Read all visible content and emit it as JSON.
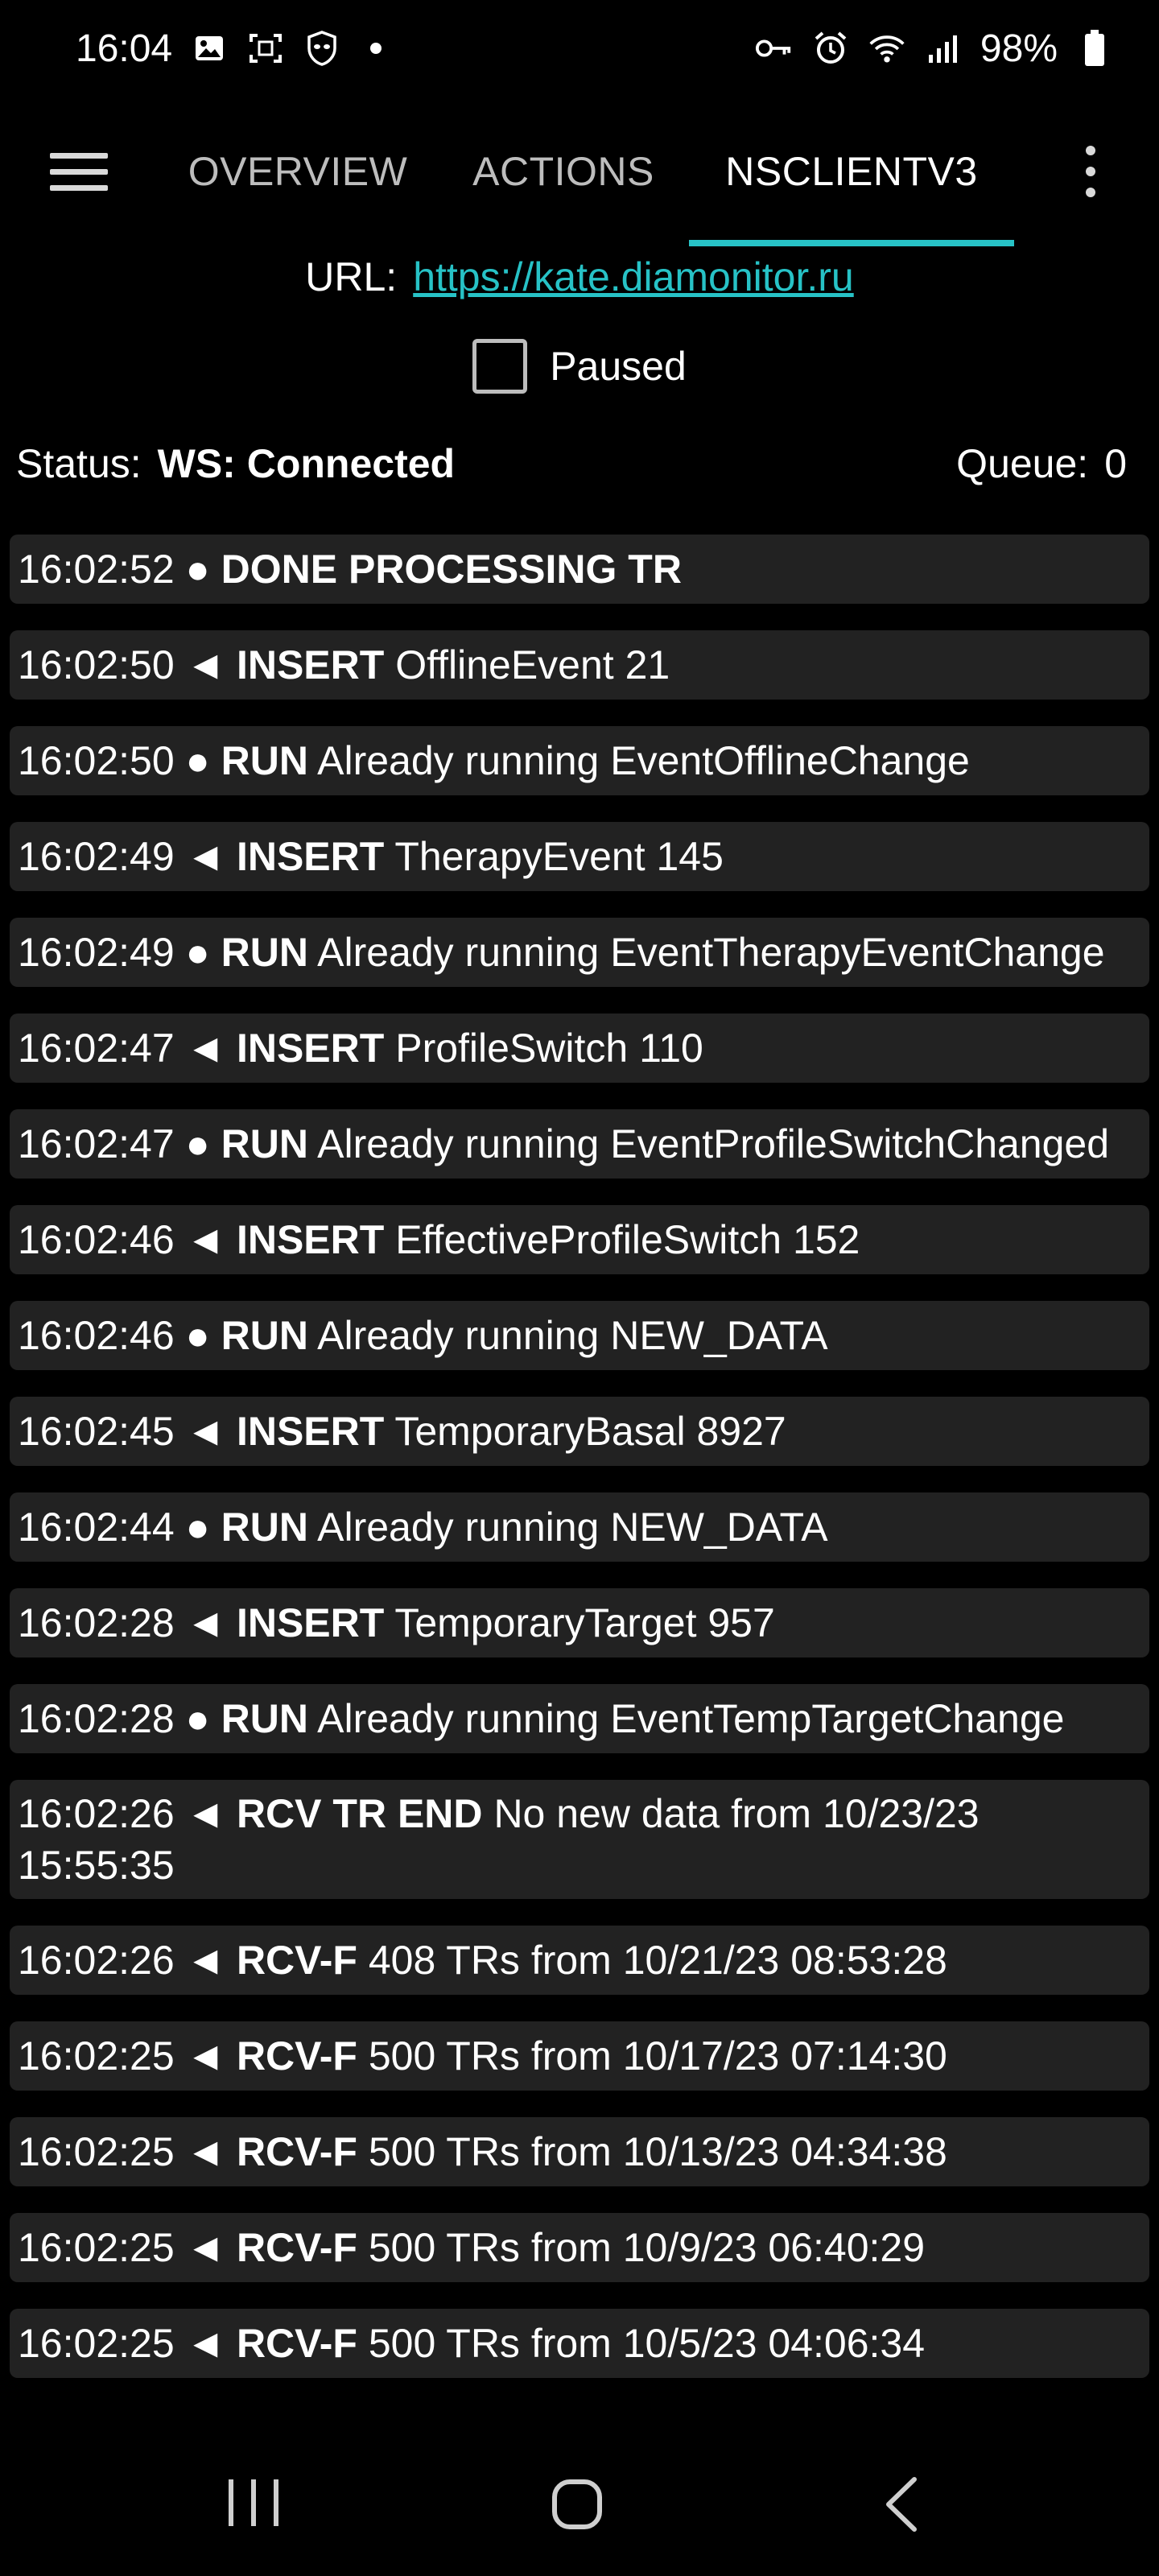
{
  "status_bar": {
    "time": "16:04",
    "left_icons": [
      "image-icon",
      "screenshot-icon",
      "alien-shield-icon",
      "notification-dot"
    ],
    "right_icons": [
      "key-icon",
      "alarm-icon",
      "wifi-icon",
      "signal-icon"
    ],
    "battery_percent": "98%"
  },
  "tabs": [
    {
      "label": "OVERVIEW",
      "active": false
    },
    {
      "label": "ACTIONS",
      "active": false
    },
    {
      "label": "NSCLIENTV3",
      "active": true
    }
  ],
  "url": {
    "label": "URL:",
    "value": "https://kate.diamonitor.ru"
  },
  "paused": {
    "label": "Paused",
    "checked": false
  },
  "status": {
    "label": "Status:",
    "value": "WS: Connected",
    "queue_label": "Queue:",
    "queue_value": "0"
  },
  "log": [
    {
      "time": "16:02:52",
      "dir": "●",
      "action": "DONE PROCESSING TR",
      "detail": ""
    },
    {
      "time": "16:02:50",
      "dir": "◄",
      "action": "INSERT",
      "detail": "OfflineEvent 21"
    },
    {
      "time": "16:02:50",
      "dir": "●",
      "action": "RUN",
      "detail": "Already running EventOfflineChange"
    },
    {
      "time": "16:02:49",
      "dir": "◄",
      "action": "INSERT",
      "detail": "TherapyEvent 145"
    },
    {
      "time": "16:02:49",
      "dir": "●",
      "action": "RUN",
      "detail": "Already running EventTherapyEventChange"
    },
    {
      "time": "16:02:47",
      "dir": "◄",
      "action": "INSERT",
      "detail": "ProfileSwitch 110"
    },
    {
      "time": "16:02:47",
      "dir": "●",
      "action": "RUN",
      "detail": "Already running EventProfileSwitchChanged"
    },
    {
      "time": "16:02:46",
      "dir": "◄",
      "action": "INSERT",
      "detail": "EffectiveProfileSwitch 152"
    },
    {
      "time": "16:02:46",
      "dir": "●",
      "action": "RUN",
      "detail": "Already running NEW_DATA"
    },
    {
      "time": "16:02:45",
      "dir": "◄",
      "action": "INSERT",
      "detail": "TemporaryBasal 8927"
    },
    {
      "time": "16:02:44",
      "dir": "●",
      "action": "RUN",
      "detail": "Already running NEW_DATA"
    },
    {
      "time": "16:02:28",
      "dir": "◄",
      "action": "INSERT",
      "detail": "TemporaryTarget 957"
    },
    {
      "time": "16:02:28",
      "dir": "●",
      "action": "RUN",
      "detail": "Already running EventTempTargetChange"
    },
    {
      "time": "16:02:26",
      "dir": "◄",
      "action": "RCV TR END",
      "detail": "No new data from 10/23/23 15:55:35"
    },
    {
      "time": "16:02:26",
      "dir": "◄",
      "action": "RCV-F",
      "detail": "408 TRs from 10/21/23 08:53:28"
    },
    {
      "time": "16:02:25",
      "dir": "◄",
      "action": "RCV-F",
      "detail": "500 TRs from 10/17/23 07:14:30"
    },
    {
      "time": "16:02:25",
      "dir": "◄",
      "action": "RCV-F",
      "detail": "500 TRs from 10/13/23 04:34:38"
    },
    {
      "time": "16:02:25",
      "dir": "◄",
      "action": "RCV-F",
      "detail": "500 TRs from 10/9/23 06:40:29"
    },
    {
      "time": "16:02:25",
      "dir": "◄",
      "action": "RCV-F",
      "detail": "500 TRs from 10/5/23 04:06:34"
    }
  ],
  "colors": {
    "accent": "#27c2c6",
    "background": "#000000",
    "log_item_bg": "#222222"
  },
  "navbar": {
    "buttons": [
      "recents-icon",
      "home-icon",
      "back-icon"
    ]
  }
}
